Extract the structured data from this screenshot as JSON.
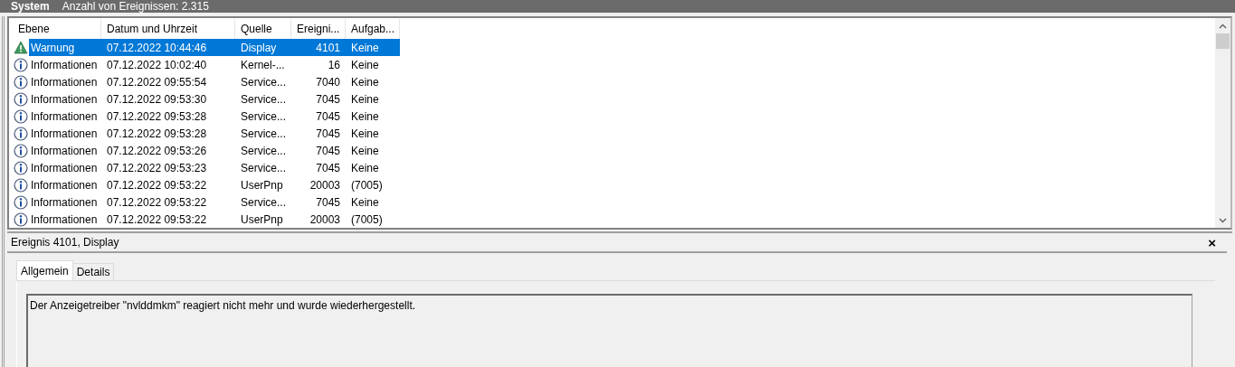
{
  "header": {
    "title": "System",
    "count": "Anzahl von Ereignissen: 2.315"
  },
  "table": {
    "columns": [
      "Ebene",
      "Datum und Uhrzeit",
      "Quelle",
      "Ereigni...",
      "Aufgab..."
    ],
    "rows": [
      {
        "kind": "warning",
        "level_text": "Warnung",
        "date": "07.12.2022 10:44:46",
        "source": "Display",
        "event_id": "4101",
        "task": "Keine",
        "selected": true
      },
      {
        "kind": "info",
        "level_text": "Informationen",
        "date": "07.12.2022 10:02:40",
        "source": "Kernel-...",
        "event_id": "16",
        "task": "Keine",
        "selected": false
      },
      {
        "kind": "info",
        "level_text": "Informationen",
        "date": "07.12.2022 09:55:54",
        "source": "Service...",
        "event_id": "7040",
        "task": "Keine",
        "selected": false
      },
      {
        "kind": "info",
        "level_text": "Informationen",
        "date": "07.12.2022 09:53:30",
        "source": "Service...",
        "event_id": "7045",
        "task": "Keine",
        "selected": false
      },
      {
        "kind": "info",
        "level_text": "Informationen",
        "date": "07.12.2022 09:53:28",
        "source": "Service...",
        "event_id": "7045",
        "task": "Keine",
        "selected": false
      },
      {
        "kind": "info",
        "level_text": "Informationen",
        "date": "07.12.2022 09:53:28",
        "source": "Service...",
        "event_id": "7045",
        "task": "Keine",
        "selected": false
      },
      {
        "kind": "info",
        "level_text": "Informationen",
        "date": "07.12.2022 09:53:26",
        "source": "Service...",
        "event_id": "7045",
        "task": "Keine",
        "selected": false
      },
      {
        "kind": "info",
        "level_text": "Informationen",
        "date": "07.12.2022 09:53:23",
        "source": "Service...",
        "event_id": "7045",
        "task": "Keine",
        "selected": false
      },
      {
        "kind": "info",
        "level_text": "Informationen",
        "date": "07.12.2022 09:53:22",
        "source": "UserPnp",
        "event_id": "20003",
        "task": "(7005)",
        "selected": false
      },
      {
        "kind": "info",
        "level_text": "Informationen",
        "date": "07.12.2022 09:53:22",
        "source": "Service...",
        "event_id": "7045",
        "task": "Keine",
        "selected": false
      },
      {
        "kind": "info",
        "level_text": "Informationen",
        "date": "07.12.2022 09:53:22",
        "source": "UserPnp",
        "event_id": "20003",
        "task": "(7005)",
        "selected": false
      }
    ]
  },
  "detail": {
    "title": "Ereignis 4101, Display",
    "close": "×",
    "tabs": [
      {
        "label": "Allgemein",
        "selected": true
      },
      {
        "label": "Details",
        "selected": false
      }
    ],
    "message": "Der Anzeigetreiber \"nvlddmkm\" reagiert nicht mehr und wurde wiederhergestellt."
  }
}
